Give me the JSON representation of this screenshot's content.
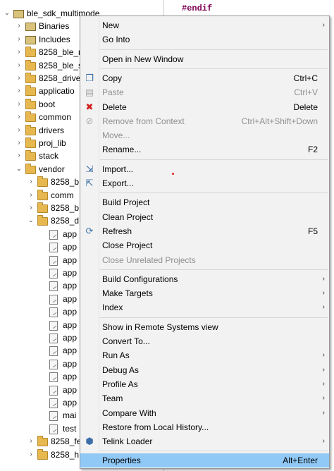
{
  "editor": {
    "code_line": "#endif"
  },
  "tree": {
    "items": [
      {
        "label": "ble_sdk_multimode",
        "depth": 0,
        "twisty": "open",
        "icon": "project-icon"
      },
      {
        "label": "Binaries",
        "depth": 1,
        "twisty": "closed",
        "icon": "binaries-icon"
      },
      {
        "label": "Includes",
        "depth": 1,
        "twisty": "closed",
        "icon": "includes-icon"
      },
      {
        "label": "8258_ble_r",
        "depth": 1,
        "twisty": "closed",
        "icon": "folder-icon"
      },
      {
        "label": "8258_ble_s",
        "depth": 1,
        "twisty": "closed",
        "icon": "folder-icon"
      },
      {
        "label": "8258_drive",
        "depth": 1,
        "twisty": "closed",
        "icon": "folder-icon"
      },
      {
        "label": "applicatio",
        "depth": 1,
        "twisty": "closed",
        "icon": "folder-icon"
      },
      {
        "label": "boot",
        "depth": 1,
        "twisty": "closed",
        "icon": "folder-icon"
      },
      {
        "label": "common",
        "depth": 1,
        "twisty": "closed",
        "icon": "folder-icon"
      },
      {
        "label": "drivers",
        "depth": 1,
        "twisty": "closed",
        "icon": "folder-icon"
      },
      {
        "label": "proj_lib",
        "depth": 1,
        "twisty": "closed",
        "icon": "folder-icon"
      },
      {
        "label": "stack",
        "depth": 1,
        "twisty": "closed",
        "icon": "folder-icon"
      },
      {
        "label": "vendor",
        "depth": 1,
        "twisty": "open",
        "icon": "folder-icon"
      },
      {
        "label": "8258_b",
        "depth": 2,
        "twisty": "closed",
        "icon": "folder-icon"
      },
      {
        "label": "comm",
        "depth": 2,
        "twisty": "closed",
        "icon": "folder-icon"
      },
      {
        "label": "8258_b",
        "depth": 2,
        "twisty": "closed",
        "icon": "folder-icon"
      },
      {
        "label": "8258_d",
        "depth": 2,
        "twisty": "open",
        "icon": "folder-icon"
      },
      {
        "label": "app",
        "depth": 3,
        "twisty": "",
        "icon": "file-icon"
      },
      {
        "label": "app",
        "depth": 3,
        "twisty": "",
        "icon": "file-icon"
      },
      {
        "label": "app",
        "depth": 3,
        "twisty": "",
        "icon": "file-icon"
      },
      {
        "label": "app",
        "depth": 3,
        "twisty": "",
        "icon": "file-icon"
      },
      {
        "label": "app",
        "depth": 3,
        "twisty": "",
        "icon": "file-icon"
      },
      {
        "label": "app",
        "depth": 3,
        "twisty": "",
        "icon": "file-icon"
      },
      {
        "label": "app",
        "depth": 3,
        "twisty": "",
        "icon": "file-icon"
      },
      {
        "label": "app",
        "depth": 3,
        "twisty": "",
        "icon": "file-icon"
      },
      {
        "label": "app",
        "depth": 3,
        "twisty": "",
        "icon": "file-icon"
      },
      {
        "label": "app",
        "depth": 3,
        "twisty": "",
        "icon": "file-icon"
      },
      {
        "label": "app",
        "depth": 3,
        "twisty": "",
        "icon": "file-icon"
      },
      {
        "label": "app",
        "depth": 3,
        "twisty": "",
        "icon": "file-icon"
      },
      {
        "label": "app",
        "depth": 3,
        "twisty": "",
        "icon": "file-icon"
      },
      {
        "label": "app",
        "depth": 3,
        "twisty": "",
        "icon": "file-icon"
      },
      {
        "label": "mai",
        "depth": 3,
        "twisty": "",
        "icon": "file-icon"
      },
      {
        "label": "test",
        "depth": 3,
        "twisty": "",
        "icon": "file-icon"
      },
      {
        "label": "8258_fe",
        "depth": 2,
        "twisty": "closed",
        "icon": "folder-icon"
      },
      {
        "label": "8258_h",
        "depth": 2,
        "twisty": "closed",
        "icon": "folder-icon"
      }
    ]
  },
  "context_menu": {
    "items": [
      {
        "label": "New",
        "shortcut": "",
        "submenu": true,
        "disabled": false,
        "icon": ""
      },
      {
        "label": "Go Into",
        "shortcut": "",
        "submenu": false,
        "disabled": false,
        "icon": ""
      },
      {
        "sep": true
      },
      {
        "label": "Open in New Window",
        "shortcut": "",
        "submenu": false,
        "disabled": false,
        "icon": ""
      },
      {
        "sep": true
      },
      {
        "label": "Copy",
        "shortcut": "Ctrl+C",
        "submenu": false,
        "disabled": false,
        "icon": "copy-icon"
      },
      {
        "label": "Paste",
        "shortcut": "Ctrl+V",
        "submenu": false,
        "disabled": true,
        "icon": "paste-icon"
      },
      {
        "label": "Delete",
        "shortcut": "Delete",
        "submenu": false,
        "disabled": false,
        "icon": "delete-icon"
      },
      {
        "label": "Remove from Context",
        "shortcut": "Ctrl+Alt+Shift+Down",
        "submenu": false,
        "disabled": true,
        "icon": "remove-context-icon"
      },
      {
        "label": "Move...",
        "shortcut": "",
        "submenu": false,
        "disabled": true,
        "icon": ""
      },
      {
        "label": "Rename...",
        "shortcut": "F2",
        "submenu": false,
        "disabled": false,
        "icon": ""
      },
      {
        "sep": true
      },
      {
        "label": "Import...",
        "shortcut": "",
        "submenu": false,
        "disabled": false,
        "icon": "import-icon"
      },
      {
        "label": "Export...",
        "shortcut": "",
        "submenu": false,
        "disabled": false,
        "icon": "export-icon"
      },
      {
        "sep": true
      },
      {
        "label": "Build Project",
        "shortcut": "",
        "submenu": false,
        "disabled": false,
        "icon": ""
      },
      {
        "label": "Clean Project",
        "shortcut": "",
        "submenu": false,
        "disabled": false,
        "icon": ""
      },
      {
        "label": "Refresh",
        "shortcut": "F5",
        "submenu": false,
        "disabled": false,
        "icon": "refresh-icon"
      },
      {
        "label": "Close Project",
        "shortcut": "",
        "submenu": false,
        "disabled": false,
        "icon": ""
      },
      {
        "label": "Close Unrelated Projects",
        "shortcut": "",
        "submenu": false,
        "disabled": true,
        "icon": ""
      },
      {
        "sep": true
      },
      {
        "label": "Build Configurations",
        "shortcut": "",
        "submenu": true,
        "disabled": false,
        "icon": ""
      },
      {
        "label": "Make Targets",
        "shortcut": "",
        "submenu": true,
        "disabled": false,
        "icon": ""
      },
      {
        "label": "Index",
        "shortcut": "",
        "submenu": true,
        "disabled": false,
        "icon": ""
      },
      {
        "sep": true
      },
      {
        "label": "Show in Remote Systems view",
        "shortcut": "",
        "submenu": false,
        "disabled": false,
        "icon": ""
      },
      {
        "label": "Convert To...",
        "shortcut": "",
        "submenu": false,
        "disabled": false,
        "icon": ""
      },
      {
        "label": "Run As",
        "shortcut": "",
        "submenu": true,
        "disabled": false,
        "icon": ""
      },
      {
        "label": "Debug As",
        "shortcut": "",
        "submenu": true,
        "disabled": false,
        "icon": ""
      },
      {
        "label": "Profile As",
        "shortcut": "",
        "submenu": true,
        "disabled": false,
        "icon": ""
      },
      {
        "label": "Team",
        "shortcut": "",
        "submenu": true,
        "disabled": false,
        "icon": ""
      },
      {
        "label": "Compare With",
        "shortcut": "",
        "submenu": true,
        "disabled": false,
        "icon": ""
      },
      {
        "label": "Restore from Local History...",
        "shortcut": "",
        "submenu": false,
        "disabled": false,
        "icon": ""
      },
      {
        "label": "Telink Loader",
        "shortcut": "",
        "submenu": true,
        "disabled": false,
        "icon": "telink-loader-icon"
      },
      {
        "sep": true
      },
      {
        "label": "Properties",
        "shortcut": "Alt+Enter",
        "submenu": false,
        "disabled": false,
        "icon": "",
        "selected": true
      }
    ]
  },
  "glyphs": {
    "twisty_open": "⌄",
    "twisty_closed": "›",
    "submenu_arrow": "›",
    "copy-icon": "❐",
    "paste-icon": "▤",
    "delete-icon": "✖",
    "remove-context-icon": "⊘",
    "import-icon": "⇲",
    "export-icon": "⇱",
    "refresh-icon": "⟳",
    "telink-loader-icon": "⬢"
  },
  "colors": {
    "delete": "#d42020",
    "selection": "#90c8f6"
  }
}
